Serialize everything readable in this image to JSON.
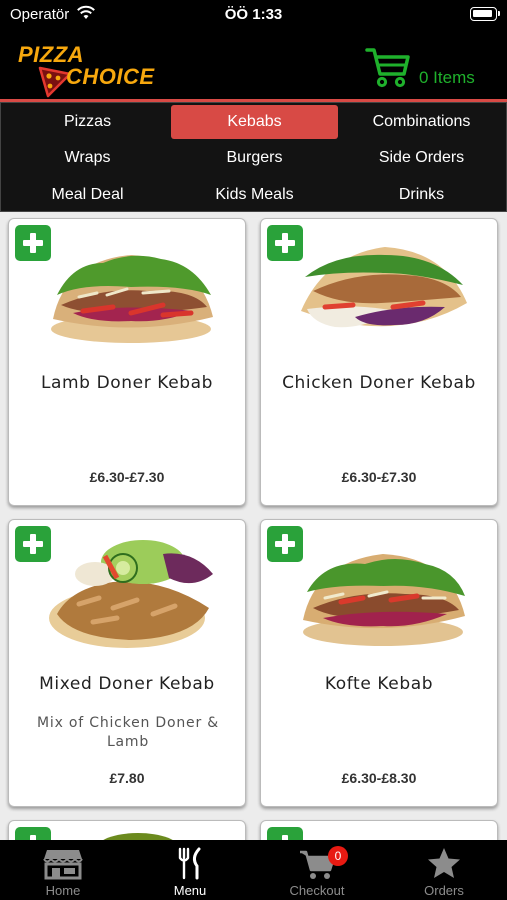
{
  "status_bar": {
    "carrier": "Operatör",
    "time": "ÖÖ 1:33"
  },
  "header": {
    "logo_line1": "PIZZA",
    "logo_line2": "CHOICE",
    "cart_items": "0 Items"
  },
  "categories": [
    {
      "label": "Pizzas",
      "active": false
    },
    {
      "label": "Kebabs",
      "active": true
    },
    {
      "label": "Combinations",
      "active": false
    },
    {
      "label": "Wraps",
      "active": false
    },
    {
      "label": "Burgers",
      "active": false
    },
    {
      "label": "Side Orders",
      "active": false
    },
    {
      "label": "Meal Deal",
      "active": false
    },
    {
      "label": "Kids Meals",
      "active": false
    },
    {
      "label": "Drinks",
      "active": false
    }
  ],
  "products": [
    {
      "name": "Lamb Doner Kebab",
      "description": "",
      "price": "£6.30-£7.30"
    },
    {
      "name": "Chicken Doner Kebab",
      "description": "",
      "price": "£6.30-£7.30"
    },
    {
      "name": "Mixed Doner Kebab",
      "description": "Mix of Chicken Doner & Lamb",
      "price": "£7.80"
    },
    {
      "name": "Kofte Kebab",
      "description": "",
      "price": "£6.30-£8.30"
    }
  ],
  "tabbar": {
    "home": "Home",
    "menu": "Menu",
    "checkout": "Checkout",
    "checkout_badge": "0",
    "orders": "Orders"
  },
  "colors": {
    "accent_red": "#d84a45",
    "cart_green": "#1fb12c",
    "add_green": "#2aa23a",
    "logo_orange": "#f7a80e"
  }
}
